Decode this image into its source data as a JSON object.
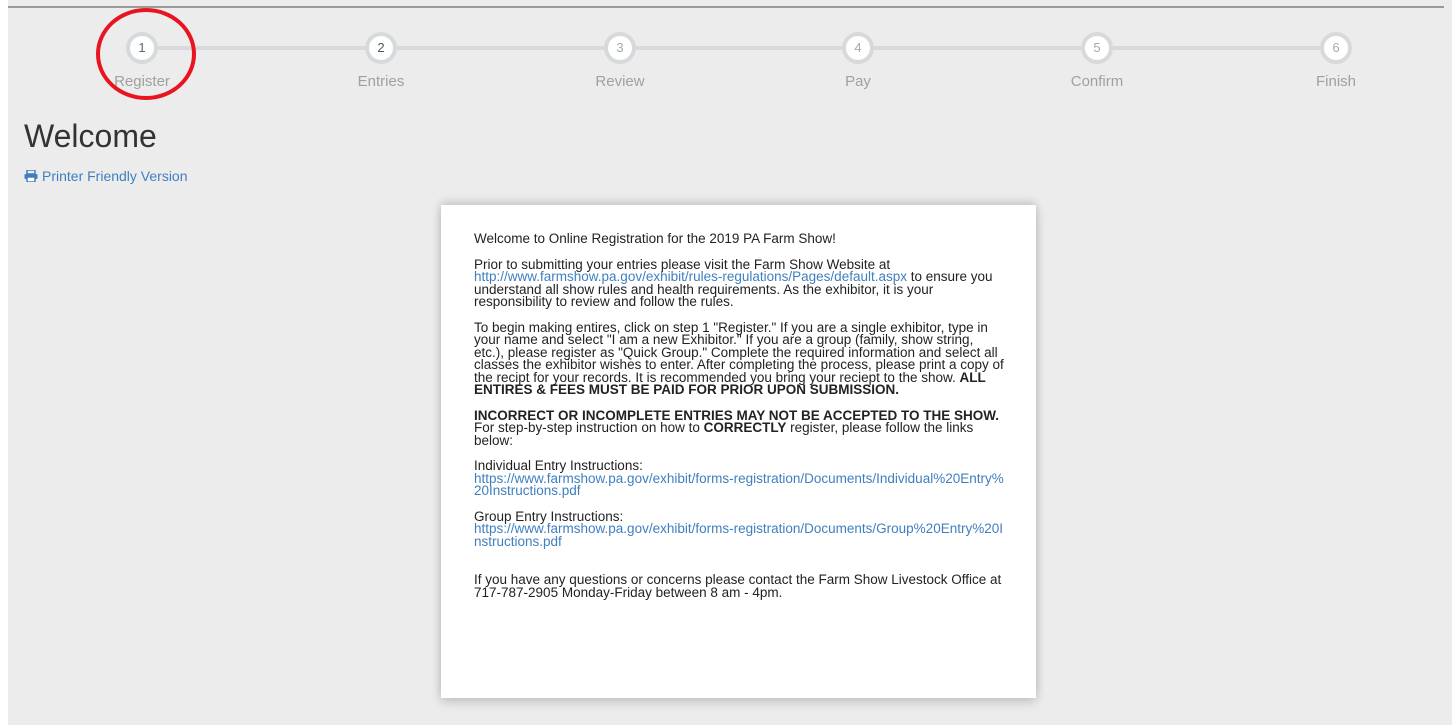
{
  "wizard": {
    "steps": [
      {
        "number": "1",
        "label": "Register"
      },
      {
        "number": "2",
        "label": "Entries"
      },
      {
        "number": "3",
        "label": "Review"
      },
      {
        "number": "4",
        "label": "Pay"
      },
      {
        "number": "5",
        "label": "Confirm"
      },
      {
        "number": "6",
        "label": "Finish"
      }
    ],
    "active_step": 1,
    "highlight_color": "#e8141f"
  },
  "page": {
    "title": "Welcome",
    "printer_link": "Printer Friendly Version"
  },
  "card": {
    "intro": "Welcome to Online Registration for the 2019 PA Farm Show!",
    "p1_pre": "Prior to submitting your entries please visit the Farm Show Website at",
    "p1_link": "http://www.farmshow.pa.gov/exhibit/rules-regulations/Pages/default.aspx",
    "p1_post": " to ensure you understand all show rules and health requirements. As the exhibitor, it is your responsibility to review and follow the rules.",
    "p2_text": "To begin making entires, click on step 1 \"Register.\"  If you are a single exhibitor, type in your name and select \"I am a new Exhibitor.\"  If you are a group (family, show string, etc.), please register as  \"Quick Group.\"  Complete the required information and select all classes the exhibitor wishes to enter.  After completing the process, please print a copy of the recipt for your records.  It is recommended you bring your reciept to the show.  ",
    "p2_bold": "ALL ENTIRES & FEES MUST BE PAID FOR PRIOR UPON SUBMISSION.",
    "p3_bold": "INCORRECT OR INCOMPLETE ENTRIES MAY NOT BE ACCEPTED TO THE SHOW.",
    "p3_pre": " For step-by-step instruction on how to ",
    "p3_bold2": "CORRECTLY",
    "p3_post": "  register, please follow the links below:",
    "individual_label": "Individual Entry Instructions:",
    "individual_link": "https://www.farmshow.pa.gov/exhibit/forms-registration/Documents/Individual%20Entry%20Instructions.pdf",
    "group_label": "Group Entry Instructions:",
    "group_link": "https://www.farmshow.pa.gov/exhibit/forms-registration/Documents/Group%20Entry%20Instructions.pdf",
    "contact": "If you have any questions or concerns please contact the Farm Show Livestock Office at 717-787-2905 Monday-Friday between 8 am - 4pm."
  }
}
